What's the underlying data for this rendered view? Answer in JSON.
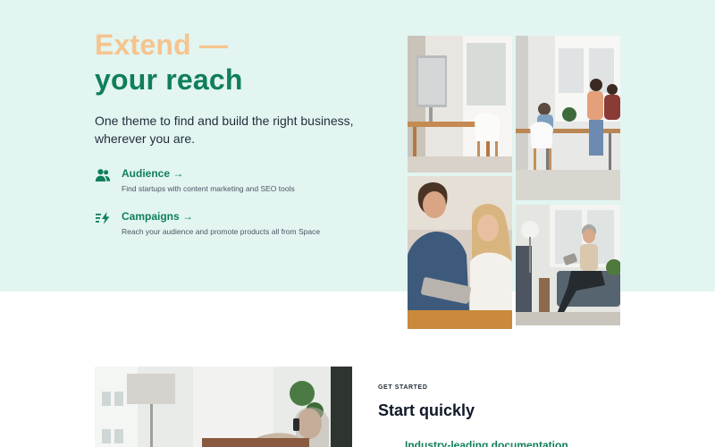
{
  "hero": {
    "title_line1": "Extend —",
    "title_line2": "your reach",
    "subtitle": "One theme to find and build the right business, wherever you are."
  },
  "features": [
    {
      "icon": "audience-icon",
      "title": "Audience →",
      "description": "Find startups with content marketing and SEO tools"
    },
    {
      "icon": "campaigns-icon",
      "title": "Campaigns →",
      "description": "Reach your audience and promote products all from Space"
    }
  ],
  "colors": {
    "hero_background": "#e2f5f1",
    "accent_green": "#0f7f5a",
    "accent_peach": "#f6c48e"
  },
  "section": {
    "eyebrow": "GET STARTED",
    "title": "Start quickly",
    "items": [
      {
        "label": "Industry-leading documentation"
      }
    ]
  }
}
